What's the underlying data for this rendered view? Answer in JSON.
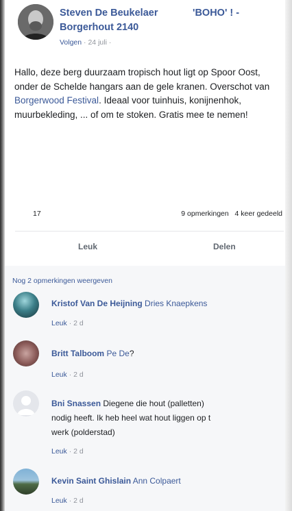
{
  "post": {
    "author": "Steven De Beukelaer",
    "group": "'BOHO' ! -",
    "group_line2": "Borgerhout 2140",
    "follow_label": "Volgen",
    "date": "24 juli",
    "text_before_link": "Hallo, deze berg duurzaam tropisch hout ligt op Spoor Oost, onder de Schelde hangars aan de gele kranen. Overschot van ",
    "link_text": "Borgerwood Festival",
    "text_after_link": ". Ideaal voor tuinhuis, konijnenhok, muurbekleding, ... of om te stoken. Gratis mee te nemen!",
    "likes_count": "17",
    "comments_count": "9 opmerkingen",
    "shares_count": "4 keer gedeeld",
    "like_button": "Leuk",
    "share_button": "Delen"
  },
  "comments_section": {
    "more_comments": "Nog 2 opmerkingen weergeven",
    "items": [
      {
        "name": "Kristof Van De Heijning",
        "tag": "Dries Knaepkens",
        "text": "",
        "like": "Leuk",
        "time": "2 d"
      },
      {
        "name": "Britt Talboom",
        "tag": "Pe De",
        "text": "?",
        "like": "Leuk",
        "time": "2 d"
      },
      {
        "name": "Bni Snassen",
        "tag": "",
        "text_line1": "Diegene die hout (palletten)",
        "text_line2": "nodig heeft. Ik heb heel wat hout liggen op t",
        "text_line3": "werk (polderstad)",
        "like": "Leuk",
        "time": "2 d"
      },
      {
        "name": "Kevin Saint Ghislain",
        "tag": "Ann Colpaert",
        "text": "",
        "like": "Leuk",
        "time": "2 d"
      }
    ]
  },
  "colors": {
    "link_blue": "#3b5998",
    "meta_grey": "#90949c",
    "comments_bg": "#f6f7f9"
  },
  "icons": [
    "default-avatar-icon"
  ]
}
